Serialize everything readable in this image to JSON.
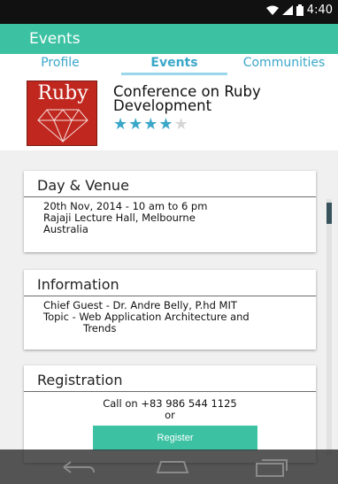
{
  "status_bar": {
    "time": "4:40",
    "icons": [
      "wifi-icon",
      "signal-icon",
      "battery-icon"
    ]
  },
  "app_bar": {
    "title": "Events"
  },
  "tabs": [
    {
      "label": "Profile",
      "selected": false
    },
    {
      "label": "Events",
      "selected": true
    },
    {
      "label": "Communities",
      "selected": false
    }
  ],
  "event": {
    "logo_text": "Ruby",
    "title": "Conference on Ruby Development",
    "rating": {
      "value": 4,
      "max": 5
    }
  },
  "sections": {
    "venue": {
      "heading": "Day & Venue",
      "lines": [
        "20th Nov, 2014 - 10 am to 6 pm",
        "Rajaji Lecture Hall, Melbourne",
        "Australia"
      ]
    },
    "information": {
      "heading": "Information",
      "lines": [
        "Chief Guest - Dr. Andre Belly, P.hd MIT",
        "Topic - Web Application Architecture  and",
        "Trends"
      ]
    },
    "registration": {
      "heading": "Registration",
      "call_text": "Call on +83 986 544 1125",
      "or_text": "or",
      "button_label": "Register"
    }
  },
  "colors": {
    "accent": "#3cc2a2",
    "tab_text": "#3aa7c9",
    "star_filled": "#3aa7c9",
    "star_empty": "#d6d6d6",
    "logo_red": "#c0281f"
  },
  "nav_bar": {
    "icons": [
      "back-icon",
      "home-icon",
      "recent-apps-icon"
    ]
  }
}
